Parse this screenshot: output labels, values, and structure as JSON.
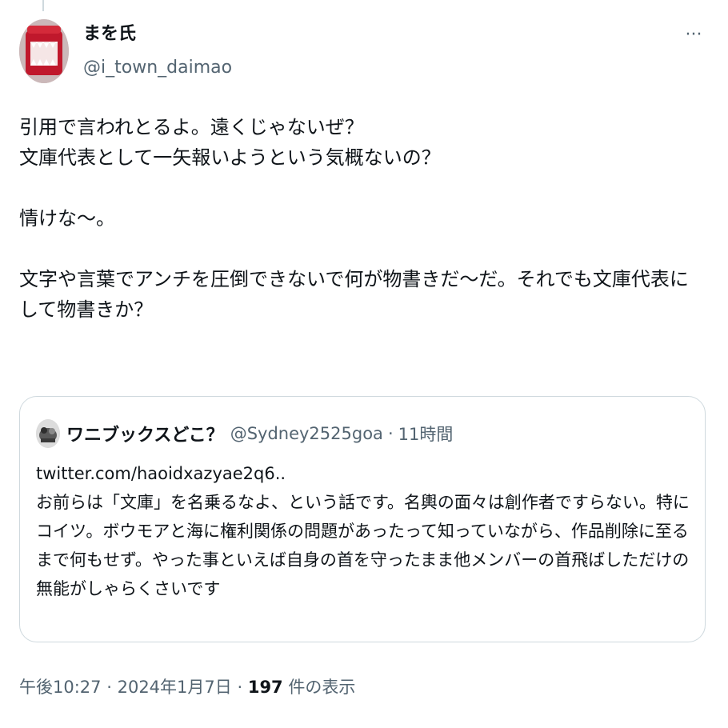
{
  "tweet": {
    "display_name": "まを氏",
    "handle": "@i_town_daimao",
    "more_label": "···",
    "text": "引用で言われとるよ。遠くじゃないぜ？\n文庫代表として一矢報いようという気概ないの？\n\n情けな〜。\n\n文字や言葉でアンチを圧倒できないで何が物書きだ〜だ。それでも文庫代表にして物書きか？"
  },
  "quote": {
    "display_name": "ワニブックスどこ？",
    "handle": "@Sydney2525goa",
    "separator": "·",
    "time": "11時間",
    "text": "twitter.com/haoidxazyae2q6..\nお前らは「文庫」を名乗るなよ、という話です。名輿の面々は創作者ですらない。特にコイツ。ボウモアと海に権利関係の問題があったって知っていながら、作品削除に至るまで何もせず。やった事といえば自身の首を守ったまま他メンバーの首飛ばしただけの無能がしゃらくさいです"
  },
  "meta": {
    "time": "午後10:27",
    "separator1": "·",
    "date": "2024年1月7日",
    "separator2": "·",
    "views_count": "197",
    "views_label": "件の表示"
  },
  "colors": {
    "text_primary": "#0f1419",
    "text_secondary": "#536471",
    "border": "#cfd9de"
  },
  "icons": {
    "more": "more-options-icon",
    "avatar": "user-avatar",
    "quote_avatar": "quoted-user-avatar"
  }
}
